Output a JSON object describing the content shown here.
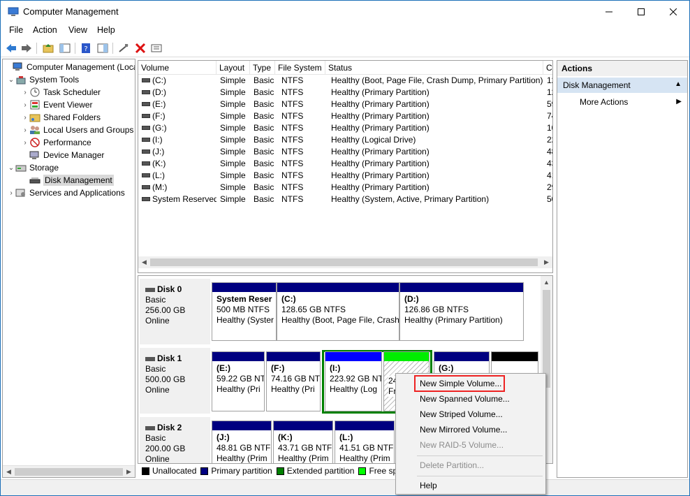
{
  "window": {
    "title": "Computer Management"
  },
  "menu": [
    "File",
    "Action",
    "View",
    "Help"
  ],
  "tree": {
    "root": "Computer Management (Local",
    "system_tools": "System Tools",
    "task_scheduler": "Task Scheduler",
    "event_viewer": "Event Viewer",
    "shared_folders": "Shared Folders",
    "local_users": "Local Users and Groups",
    "performance": "Performance",
    "device_manager": "Device Manager",
    "storage": "Storage",
    "disk_management": "Disk Management",
    "services": "Services and Applications"
  },
  "volumes": {
    "headers": [
      "Volume",
      "Layout",
      "Type",
      "File System",
      "Status",
      "C"
    ],
    "rows": [
      {
        "volume": "(C:)",
        "layout": "Simple",
        "type": "Basic",
        "fs": "NTFS",
        "status": "Healthy (Boot, Page File, Crash Dump, Primary Partition)",
        "cap": "12"
      },
      {
        "volume": "(D:)",
        "layout": "Simple",
        "type": "Basic",
        "fs": "NTFS",
        "status": "Healthy (Primary Partition)",
        "cap": "12"
      },
      {
        "volume": "(E:)",
        "layout": "Simple",
        "type": "Basic",
        "fs": "NTFS",
        "status": "Healthy (Primary Partition)",
        "cap": "59"
      },
      {
        "volume": "(F:)",
        "layout": "Simple",
        "type": "Basic",
        "fs": "NTFS",
        "status": "Healthy (Primary Partition)",
        "cap": "74"
      },
      {
        "volume": "(G:)",
        "layout": "Simple",
        "type": "Basic",
        "fs": "NTFS",
        "status": "Healthy (Primary Partition)",
        "cap": "10"
      },
      {
        "volume": "(I:)",
        "layout": "Simple",
        "type": "Basic",
        "fs": "NTFS",
        "status": "Healthy (Logical Drive)",
        "cap": "22"
      },
      {
        "volume": "(J:)",
        "layout": "Simple",
        "type": "Basic",
        "fs": "NTFS",
        "status": "Healthy (Primary Partition)",
        "cap": "48"
      },
      {
        "volume": "(K:)",
        "layout": "Simple",
        "type": "Basic",
        "fs": "NTFS",
        "status": "Healthy (Primary Partition)",
        "cap": "43"
      },
      {
        "volume": "(L:)",
        "layout": "Simple",
        "type": "Basic",
        "fs": "NTFS",
        "status": "Healthy (Primary Partition)",
        "cap": "41"
      },
      {
        "volume": "(M:)",
        "layout": "Simple",
        "type": "Basic",
        "fs": "NTFS",
        "status": "Healthy (Primary Partition)",
        "cap": "29"
      },
      {
        "volume": "System Reserved",
        "layout": "Simple",
        "type": "Basic",
        "fs": "NTFS",
        "status": "Healthy (System, Active, Primary Partition)",
        "cap": "50"
      }
    ]
  },
  "disks": [
    {
      "name": "Disk 0",
      "type": "Basic",
      "size": "256.00 GB",
      "state": "Online",
      "parts": [
        {
          "label": "System Reser",
          "size": "500 MB NTFS",
          "status": "Healthy (Syster"
        },
        {
          "label": "(C:)",
          "size": "128.65 GB NTFS",
          "status": "Healthy (Boot, Page File, Crash"
        },
        {
          "label": "(D:)",
          "size": "126.86 GB NTFS",
          "status": "Healthy (Primary Partition)"
        }
      ]
    },
    {
      "name": "Disk 1",
      "type": "Basic",
      "size": "500.00 GB",
      "state": "Online",
      "parts": [
        {
          "label": "(E:)",
          "size": "59.22 GB NTF",
          "status": "Healthy (Pri"
        },
        {
          "label": "(F:)",
          "size": "74.16 GB NT",
          "status": "Healthy (Pri"
        },
        {
          "label": "(I:)",
          "size": "223.92 GB NT",
          "status": "Healthy (Log"
        },
        {
          "label": "",
          "size": "24",
          "status": "Fr"
        },
        {
          "label": "(G:)",
          "size": "",
          "status": ""
        },
        {
          "label": "",
          "size": "",
          "status": ""
        }
      ]
    },
    {
      "name": "Disk 2",
      "type": "Basic",
      "size": "200.00 GB",
      "state": "Online",
      "parts": [
        {
          "label": "(J:)",
          "size": "48.81 GB NTF",
          "status": "Healthy (Prim"
        },
        {
          "label": "(K:)",
          "size": "43.71 GB NTF",
          "status": "Healthy (Prim"
        },
        {
          "label": "(L:)",
          "size": "41.51 GB NTF",
          "status": "Healthy (Prim"
        }
      ]
    }
  ],
  "legend": [
    "Unallocated",
    "Primary partition",
    "Extended partition",
    "Free sp"
  ],
  "colors": {
    "unallocated": "#000000",
    "primary": "#000080",
    "extended": "#008000",
    "free": "#00ff00",
    "logical": "#0000ff",
    "highlight": "#e22222"
  },
  "actions": {
    "header": "Actions",
    "section": "Disk Management",
    "more": "More Actions"
  },
  "context_menu": {
    "new_simple": "New Simple Volume...",
    "new_spanned": "New Spanned Volume...",
    "new_striped": "New Striped Volume...",
    "new_mirrored": "New Mirrored Volume...",
    "new_raid5": "New RAID-5 Volume...",
    "delete": "Delete Partition...",
    "help": "Help"
  }
}
